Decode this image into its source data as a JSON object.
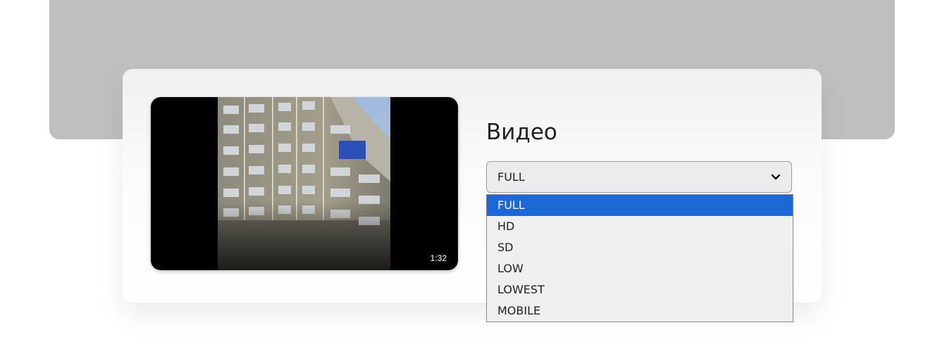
{
  "section": {
    "title": "Видео"
  },
  "video": {
    "duration": "1:32"
  },
  "select": {
    "value": "FULL",
    "options": [
      {
        "label": "FULL",
        "selected": true
      },
      {
        "label": "HD",
        "selected": false
      },
      {
        "label": "SD",
        "selected": false
      },
      {
        "label": "LOW",
        "selected": false
      },
      {
        "label": "LOWEST",
        "selected": false
      },
      {
        "label": "MOBILE",
        "selected": false
      }
    ]
  },
  "colors": {
    "accent": "#1a69d6",
    "banner": "#bfbfbf",
    "select_bg": "#ececec"
  },
  "icons": {
    "chevron": "chevron-down-icon",
    "play_thumb": "video-thumbnail"
  }
}
